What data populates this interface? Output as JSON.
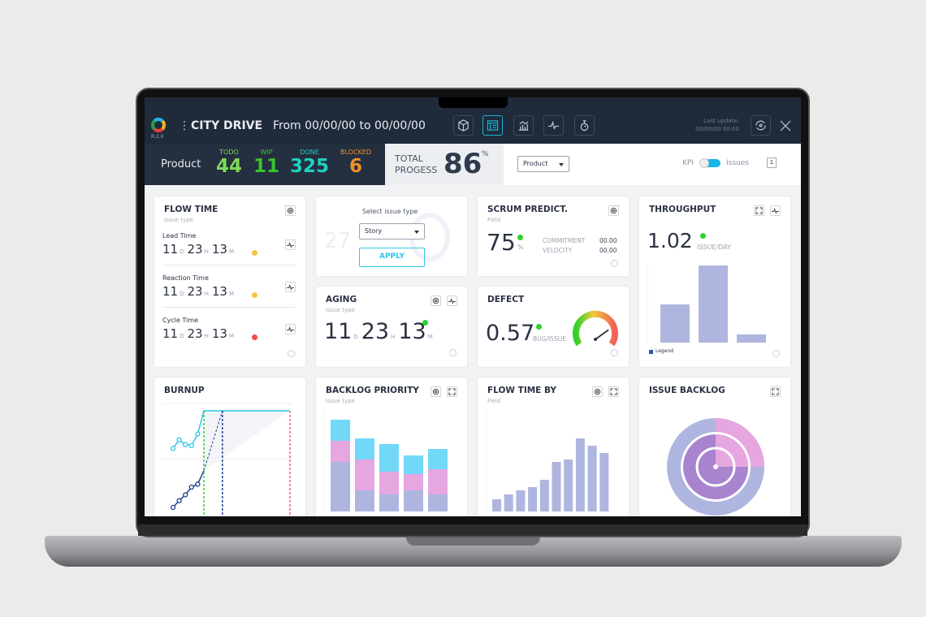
{
  "header": {
    "version": "R.2.0",
    "title": "CITY DRIVE",
    "date_range": "From 00/00/00 to 00/00/00",
    "last_update_label": "Last update:",
    "last_update_value": "00/00/00 00:00",
    "icons": [
      "cube-icon",
      "dashboard-icon",
      "chart-icon",
      "pulse-icon",
      "timer-icon"
    ],
    "active_icon": "dashboard-icon"
  },
  "stats": {
    "label": "Product",
    "items": [
      {
        "label": "TODO",
        "value": "44",
        "color": "#7ed957"
      },
      {
        "label": "WIP",
        "value": "11",
        "color": "#39c42b"
      },
      {
        "label": "DONE",
        "value": "325",
        "color": "#1fd1c1"
      },
      {
        "label": "BLOCKED",
        "value": "6",
        "color": "#f2902a"
      }
    ]
  },
  "progress": {
    "label_line1": "TOTAL",
    "label_line2": "PROGESS",
    "value": "86",
    "unit": "%"
  },
  "filters": {
    "product_select": "Product",
    "kpi_label": "KPI",
    "issues_label": "Issues",
    "toggle_on": true,
    "page": "1"
  },
  "flow_time": {
    "title": "FLOW TIME",
    "subtitle": "Issue type",
    "rows": [
      {
        "label": "Lead Time",
        "d": "11",
        "h": "23",
        "m": "13",
        "status": "#f5c542"
      },
      {
        "label": "Reaction Time",
        "d": "11",
        "h": "23",
        "m": "13",
        "status": "#f5c542"
      },
      {
        "label": "Cycle Time",
        "d": "11",
        "h": "23",
        "m": "13",
        "status": "#ef4b4b"
      }
    ],
    "units": {
      "d": "D",
      "h": "H",
      "m": "M"
    }
  },
  "efficiency": {
    "faded_value": "27",
    "select_label": "Select issue type",
    "select_value": "Story",
    "apply": "APPLY"
  },
  "scrum": {
    "title": "SCRUM PREDICT.",
    "subtitle": "Field",
    "value": "75",
    "unit": "%",
    "commitment_label": "COMMITMENT",
    "commitment": "00.00",
    "velocity_label": "VELOCITY",
    "velocity": "00.00"
  },
  "throughput": {
    "title": "THROUGHPUT",
    "value": "1.02",
    "unit": "ISSUE/DAY",
    "legend": "Legend",
    "bars": [
      47,
      95,
      10
    ]
  },
  "aging": {
    "title": "AGING",
    "subtitle": "Issue type",
    "d": "11",
    "h": "23",
    "m": "13"
  },
  "defect": {
    "title": "DEFECT",
    "value": "0.57",
    "unit": "BUG/ISSUE",
    "gauge_level": 0.7
  },
  "burnup": {
    "title": "BURNUP",
    "scope": [
      61,
      70,
      65,
      64,
      76,
      100,
      100
    ],
    "done": [
      0,
      7,
      13,
      21,
      24,
      38
    ],
    "projection": [
      38,
      100
    ]
  },
  "backlog_priority": {
    "title": "BACKLOG PRIORITY",
    "subtitle": "Issue type",
    "series": [
      {
        "color": "#aeb6e0",
        "values": [
          61,
          26,
          21,
          26,
          21
        ]
      },
      {
        "color": "#e6a6e0",
        "values": [
          26,
          38,
          28,
          20,
          31
        ]
      },
      {
        "color": "#72d8f7",
        "values": [
          26,
          26,
          34,
          23,
          25
        ]
      }
    ]
  },
  "flow_time_by": {
    "title": "FLOW TIME BY",
    "subtitle": "Field",
    "values": [
      15,
      21,
      26,
      30,
      39,
      61,
      64,
      90,
      81,
      72
    ]
  },
  "issue_backlog": {
    "title": "ISSUE BACKLOG"
  }
}
